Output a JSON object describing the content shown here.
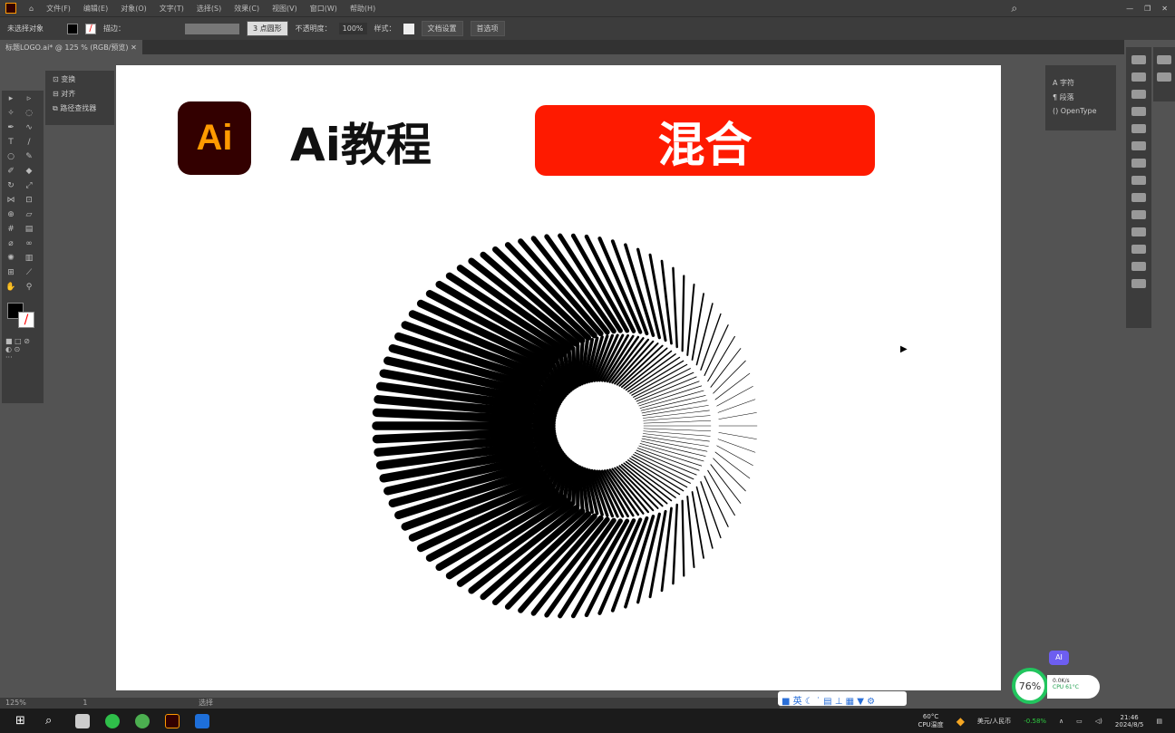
{
  "menu": [
    "文件(F)",
    "编辑(E)",
    "对象(O)",
    "文字(T)",
    "选择(S)",
    "效果(C)",
    "视图(V)",
    "窗口(W)",
    "帮助(H)"
  ],
  "control": {
    "selection": "未选择对象",
    "stroke_label": "描边：",
    "brush": "3 点圆形",
    "opacity_label": "不透明度：",
    "opacity": "100%",
    "style_label": "样式：",
    "doc_setup": "文档设置",
    "prefs": "首选项"
  },
  "tab": "标题LOGO.ai* @ 125 % (RGB/预览)",
  "left_panel": [
    "变换",
    "对齐",
    "路径查找器"
  ],
  "right_panel": [
    "字符",
    "段落",
    "OpenType"
  ],
  "artboard": {
    "logo": "Ai",
    "title": "Ai教程",
    "badge": "混合",
    "badge_color": "#fe1a00"
  },
  "status": {
    "zoom": "125%",
    "page": "1",
    "tool": "选择"
  },
  "widget": {
    "percent": "76%",
    "net": "0.0K/s",
    "cpu": "CPU 61°C",
    "ai": "AI"
  },
  "taskbar": {
    "cpu_temp": "60°C",
    "cpu_label": "CPU温度",
    "fx": "美元/人民币",
    "fx_change": "-0.58%",
    "time": "21:46",
    "date": "2024/8/5"
  }
}
